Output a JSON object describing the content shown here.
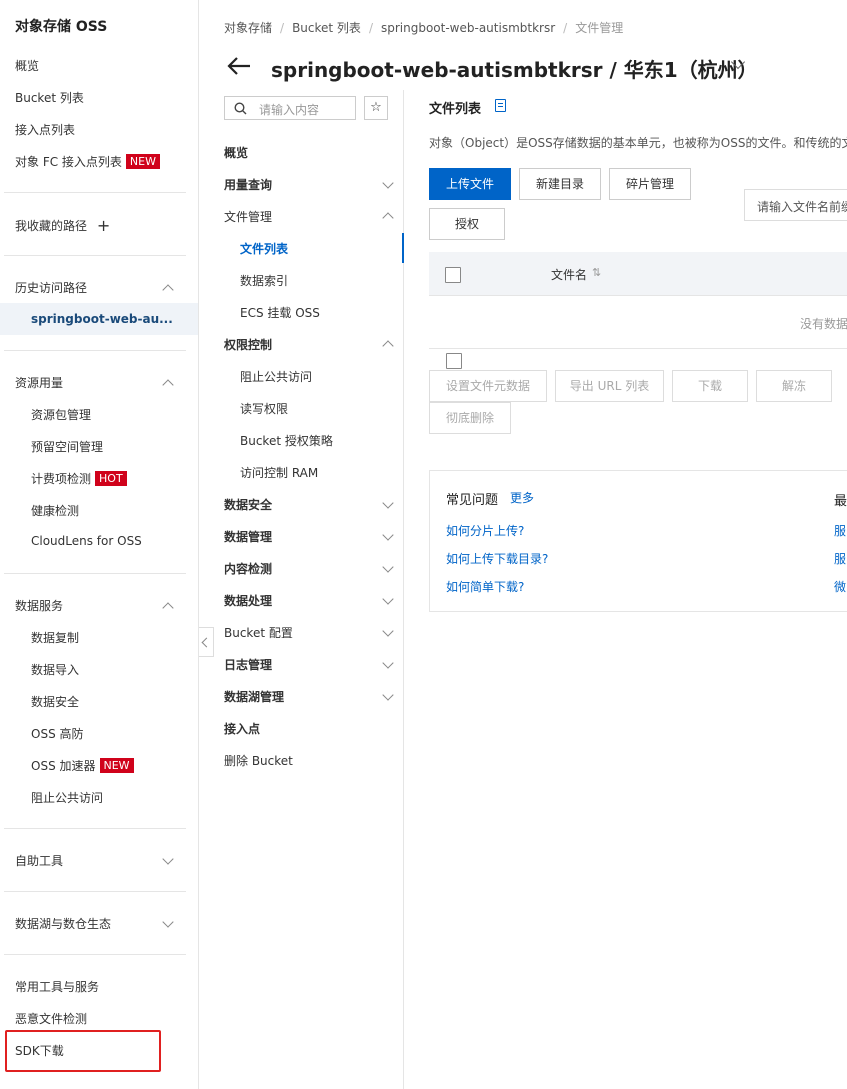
{
  "sidebar": {
    "title": "对象存储 OSS",
    "top_items": [
      "概览",
      "Bucket 列表",
      "接入点列表"
    ],
    "fc_item": {
      "label": "对象 FC 接入点列表",
      "badge": "NEW"
    },
    "favorites": "我收藏的路径",
    "history_head": "历史访问路径",
    "history_active": "springboot-web-au...",
    "resource_head": "资源用量",
    "resource_items": [
      "资源包管理",
      "预留空间管理"
    ],
    "billing_item": {
      "label": "计费项检测",
      "badge": "HOT"
    },
    "resource_items2": [
      "健康检测",
      "CloudLens for OSS"
    ],
    "data_head": "数据服务",
    "data_items": [
      "数据复制",
      "数据导入",
      "数据安全",
      "OSS 高防"
    ],
    "accel_item": {
      "label": "OSS 加速器",
      "badge": "NEW"
    },
    "data_items2": [
      "阻止公共访问"
    ],
    "selfhelp": "自助工具",
    "datalake": "数据湖与数仓生态",
    "bottom_items": [
      "常用工具与服务",
      "恶意文件检测",
      "SDK下载"
    ]
  },
  "breadcrumb": [
    "对象存储",
    "Bucket 列表",
    "springboot-web-autismbtkrsr",
    "文件管理"
  ],
  "page_title": "springboot-web-autismbtkrsr / 华东1（杭州）",
  "midnav": {
    "search_placeholder": "请输入内容",
    "star": "☆",
    "items": {
      "overview": "概览",
      "usage": "用量查询",
      "files": "文件管理",
      "file_list": "文件列表",
      "data_index": "数据索引",
      "ecs": "ECS 挂载 OSS",
      "perm": "权限控制",
      "block_public": "阻止公共访问",
      "rw": "读写权限",
      "bucket_policy": "Bucket 授权策略",
      "ram": "访问控制 RAM",
      "data_security": "数据安全",
      "data_mgmt": "数据管理",
      "content_check": "内容检测",
      "data_process": "数据处理",
      "bucket_config": "Bucket 配置",
      "log_mgmt": "日志管理",
      "datalake_mgmt": "数据湖管理",
      "access_point": "接入点",
      "delete_bucket": "删除 Bucket"
    }
  },
  "main": {
    "heading": "文件列表",
    "description": "对象（Object）是OSS存储数据的基本单元，也被称为OSS的文件。和传统的文件",
    "buttons": {
      "upload": "上传文件",
      "new_dir": "新建目录",
      "fragments": "碎片管理",
      "authorize": "授权"
    },
    "search_placeholder": "请输入文件名前缀",
    "table": {
      "col_name": "文件名",
      "sort": "⇅",
      "empty": "没有数据"
    },
    "batch": {
      "meta": "设置文件元数据",
      "export": "导出 URL 列表",
      "download": "下载",
      "unfreeze": "解冻",
      "delete": "彻底删除"
    },
    "faq": {
      "title": "常见问题",
      "more": "更多",
      "links": [
        "如何分片上传?",
        "如何上传下载目录?",
        "如何简单下载?"
      ],
      "right_head": "最",
      "right_links": [
        "服",
        "服",
        "微"
      ]
    }
  },
  "colors": {
    "primary": "#0064c8",
    "badge": "#d0021b",
    "highlight": "#e02020"
  }
}
